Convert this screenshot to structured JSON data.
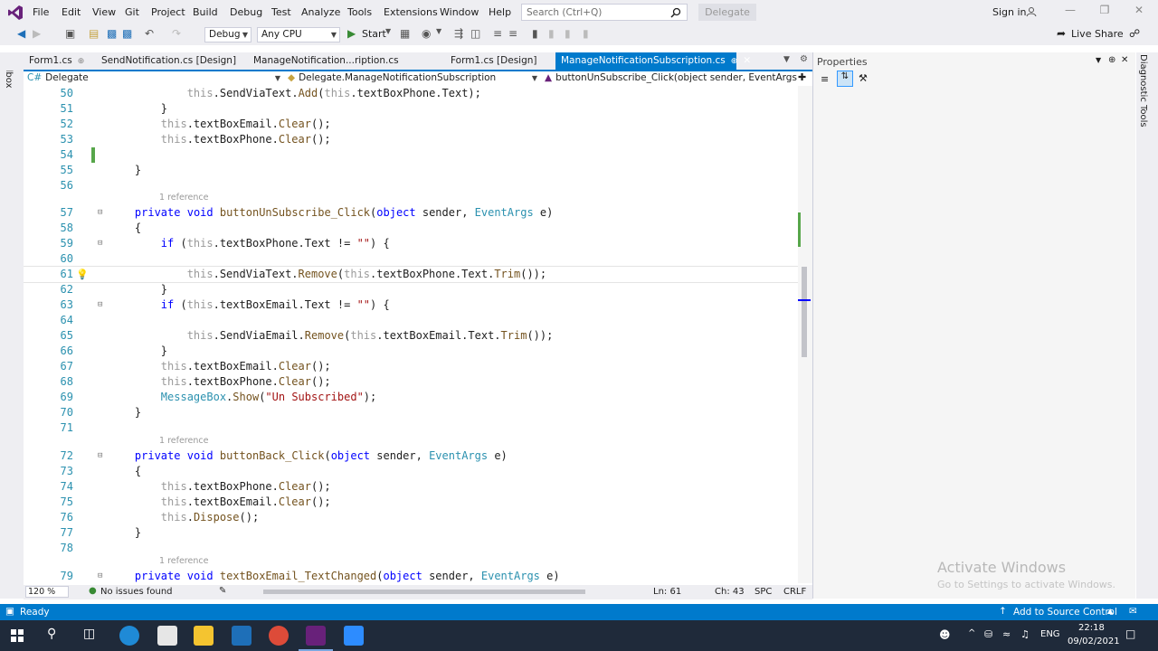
{
  "menu": {
    "items": [
      "File",
      "Edit",
      "View",
      "Git",
      "Project",
      "Build",
      "Debug",
      "Test",
      "Analyze",
      "Tools",
      "Extensions",
      "Window",
      "Help"
    ],
    "search_placeholder": "Search (Ctrl+Q)",
    "solution_name": "Delegate",
    "sign_in": "Sign in"
  },
  "toolbar": {
    "config": "Debug",
    "platform": "Any CPU",
    "start": "Start",
    "live_share": "Live Share"
  },
  "tabs": [
    {
      "label": "Form1.cs",
      "active": false
    },
    {
      "label": "SendNotification.cs [Design]",
      "active": false
    },
    {
      "label": "ManageNotification...ription.cs [Design]",
      "active": false
    },
    {
      "label": "Form1.cs [Design]",
      "active": false
    },
    {
      "label": "ManageNotificationSubscription.cs",
      "active": true
    }
  ],
  "navbar": {
    "project": "Delegate",
    "class": "Delegate.ManageNotificationSubscription",
    "member": "buttonUnSubscribe_Click(object sender, EventArgs e)"
  },
  "side_labels": {
    "toolbox": "Toolbox",
    "diagnostic": "Diagnostic Tools"
  },
  "properties_title": "Properties",
  "code_lines": [
    {
      "n": "50",
      "ref": "",
      "indent": "            ",
      "parts": [
        [
          "kw2",
          "this"
        ],
        [
          "",
          "."
        ],
        [
          "",
          "SendViaText"
        ],
        [
          "",
          "."
        ],
        [
          "mth",
          "Add"
        ],
        [
          "",
          "("
        ],
        [
          "kw2",
          "this"
        ],
        [
          "",
          ".textBoxPhone.Text);"
        ]
      ]
    },
    {
      "n": "51",
      "ref": "",
      "indent": "        ",
      "parts": [
        [
          "",
          "}"
        ]
      ]
    },
    {
      "n": "52",
      "ref": "",
      "indent": "        ",
      "parts": [
        [
          "kw2",
          "this"
        ],
        [
          "",
          ".textBoxEmail."
        ],
        [
          "mth",
          "Clear"
        ],
        [
          "",
          "();"
        ]
      ]
    },
    {
      "n": "53",
      "ref": "",
      "indent": "        ",
      "parts": [
        [
          "kw2",
          "this"
        ],
        [
          "",
          ".textBoxPhone."
        ],
        [
          "mth",
          "Clear"
        ],
        [
          "",
          "();"
        ]
      ]
    },
    {
      "n": "54",
      "ref": "",
      "indent": "",
      "parts": []
    },
    {
      "n": "55",
      "ref": "",
      "indent": "    ",
      "parts": [
        [
          "",
          "}"
        ]
      ]
    },
    {
      "n": "56",
      "ref": "",
      "indent": "",
      "parts": []
    },
    {
      "n": "57",
      "ref": "1 reference",
      "indent": "    ",
      "parts": [
        [
          "kw",
          "private"
        ],
        [
          "",
          " "
        ],
        [
          "kw",
          "void"
        ],
        [
          "",
          " "
        ],
        [
          "mth",
          "buttonUnSubscribe_Click"
        ],
        [
          "",
          "("
        ],
        [
          "kw",
          "object"
        ],
        [
          "",
          " sender, "
        ],
        [
          "typ",
          "EventArgs"
        ],
        [
          "",
          " e)"
        ]
      ]
    },
    {
      "n": "58",
      "ref": "",
      "indent": "    ",
      "parts": [
        [
          "",
          "{"
        ]
      ]
    },
    {
      "n": "59",
      "ref": "",
      "indent": "        ",
      "parts": [
        [
          "kw",
          "if"
        ],
        [
          "",
          " ("
        ],
        [
          "kw2",
          "this"
        ],
        [
          "",
          ".textBoxPhone.Text != "
        ],
        [
          "str",
          "\"\""
        ],
        [
          "",
          ") {"
        ]
      ]
    },
    {
      "n": "60",
      "ref": "",
      "indent": "",
      "parts": []
    },
    {
      "n": "61",
      "ref": "",
      "indent": "            ",
      "parts": [
        [
          "kw2",
          "this"
        ],
        [
          "",
          ".SendViaText."
        ],
        [
          "mth",
          "Remove"
        ],
        [
          "",
          "("
        ],
        [
          "kw2",
          "this"
        ],
        [
          "",
          ".textBoxPhone.Text."
        ],
        [
          "mth",
          "Trim"
        ],
        [
          "",
          "());"
        ]
      ]
    },
    {
      "n": "62",
      "ref": "",
      "indent": "        ",
      "parts": [
        [
          "",
          "}"
        ]
      ]
    },
    {
      "n": "63",
      "ref": "",
      "indent": "        ",
      "parts": [
        [
          "kw",
          "if"
        ],
        [
          "",
          " ("
        ],
        [
          "kw2",
          "this"
        ],
        [
          "",
          ".textBoxEmail.Text != "
        ],
        [
          "str",
          "\"\""
        ],
        [
          "",
          ") {"
        ]
      ]
    },
    {
      "n": "64",
      "ref": "",
      "indent": "",
      "parts": []
    },
    {
      "n": "65",
      "ref": "",
      "indent": "            ",
      "parts": [
        [
          "kw2",
          "this"
        ],
        [
          "",
          ".SendViaEmail."
        ],
        [
          "mth",
          "Remove"
        ],
        [
          "",
          "("
        ],
        [
          "kw2",
          "this"
        ],
        [
          "",
          ".textBoxEmail.Text."
        ],
        [
          "mth",
          "Trim"
        ],
        [
          "",
          "());"
        ]
      ]
    },
    {
      "n": "66",
      "ref": "",
      "indent": "        ",
      "parts": [
        [
          "",
          "}"
        ]
      ]
    },
    {
      "n": "67",
      "ref": "",
      "indent": "        ",
      "parts": [
        [
          "kw2",
          "this"
        ],
        [
          "",
          ".textBoxEmail."
        ],
        [
          "mth",
          "Clear"
        ],
        [
          "",
          "();"
        ]
      ]
    },
    {
      "n": "68",
      "ref": "",
      "indent": "        ",
      "parts": [
        [
          "kw2",
          "this"
        ],
        [
          "",
          ".textBoxPhone."
        ],
        [
          "mth",
          "Clear"
        ],
        [
          "",
          "();"
        ]
      ]
    },
    {
      "n": "69",
      "ref": "",
      "indent": "        ",
      "parts": [
        [
          "typ",
          "MessageBox"
        ],
        [
          "",
          "."
        ],
        [
          "mth",
          "Show"
        ],
        [
          "",
          "("
        ],
        [
          "str",
          "\"Un Subscribed\""
        ],
        [
          "",
          ");"
        ]
      ]
    },
    {
      "n": "70",
      "ref": "",
      "indent": "    ",
      "parts": [
        [
          "",
          "}"
        ]
      ]
    },
    {
      "n": "71",
      "ref": "",
      "indent": "",
      "parts": []
    },
    {
      "n": "72",
      "ref": "1 reference",
      "indent": "    ",
      "parts": [
        [
          "kw",
          "private"
        ],
        [
          "",
          " "
        ],
        [
          "kw",
          "void"
        ],
        [
          "",
          " "
        ],
        [
          "mth",
          "buttonBack_Click"
        ],
        [
          "",
          "("
        ],
        [
          "kw",
          "object"
        ],
        [
          "",
          " sender, "
        ],
        [
          "typ",
          "EventArgs"
        ],
        [
          "",
          " e)"
        ]
      ]
    },
    {
      "n": "73",
      "ref": "",
      "indent": "    ",
      "parts": [
        [
          "",
          "{"
        ]
      ]
    },
    {
      "n": "74",
      "ref": "",
      "indent": "        ",
      "parts": [
        [
          "kw2",
          "this"
        ],
        [
          "",
          ".textBoxPhone."
        ],
        [
          "mth",
          "Clear"
        ],
        [
          "",
          "();"
        ]
      ]
    },
    {
      "n": "75",
      "ref": "",
      "indent": "        ",
      "parts": [
        [
          "kw2",
          "this"
        ],
        [
          "",
          ".textBoxEmail."
        ],
        [
          "mth",
          "Clear"
        ],
        [
          "",
          "();"
        ]
      ]
    },
    {
      "n": "76",
      "ref": "",
      "indent": "        ",
      "parts": [
        [
          "kw2",
          "this"
        ],
        [
          "",
          "."
        ],
        [
          "mth",
          "Dispose"
        ],
        [
          "",
          "();"
        ]
      ]
    },
    {
      "n": "77",
      "ref": "",
      "indent": "    ",
      "parts": [
        [
          "",
          "}"
        ]
      ]
    },
    {
      "n": "78",
      "ref": "",
      "indent": "",
      "parts": []
    },
    {
      "n": "79",
      "ref": "1 reference",
      "indent": "    ",
      "parts": [
        [
          "kw",
          "private"
        ],
        [
          "",
          " "
        ],
        [
          "kw",
          "void"
        ],
        [
          "",
          " "
        ],
        [
          "mth",
          "textBoxEmail_TextChanged"
        ],
        [
          "",
          "("
        ],
        [
          "kw",
          "object"
        ],
        [
          "",
          " sender, "
        ],
        [
          "typ",
          "EventArgs"
        ],
        [
          "",
          " e)"
        ]
      ]
    }
  ],
  "editor_status": {
    "zoom": "120 %",
    "issues": "No issues found",
    "line": "Ln: 61",
    "col": "Ch: 43",
    "spc": "SPC",
    "crlf": "CRLF"
  },
  "watermark": {
    "title": "Activate Windows",
    "subtitle": "Go to Settings to activate Windows."
  },
  "statusbar": {
    "ready": "Ready",
    "source_control": "Add to Source Control"
  },
  "taskbar": {
    "lang": "ENG",
    "time": "22:18",
    "date": "09/02/2021"
  },
  "colors": {
    "accent": "#007acc",
    "keyword": "#0000ff",
    "type": "#2b91af",
    "string": "#a31515"
  }
}
